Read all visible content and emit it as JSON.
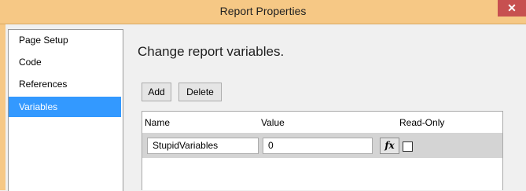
{
  "window": {
    "title": "Report Properties",
    "close_glyph": "✕"
  },
  "sidebar": {
    "items": [
      {
        "label": "Page Setup"
      },
      {
        "label": "Code"
      },
      {
        "label": "References"
      },
      {
        "label": "Variables",
        "selected": true
      }
    ]
  },
  "main": {
    "heading": "Change report variables.",
    "add_label": "Add",
    "delete_label": "Delete",
    "columns": [
      "Name",
      "Value",
      "Read-Only"
    ],
    "rows": [
      {
        "name": "StupidVariables",
        "value": "0",
        "fx_label": "fx",
        "read_only": false
      }
    ]
  },
  "colors": {
    "titlebar": "#f6c885",
    "selection": "#3399ff",
    "close_button": "#c75050",
    "row_background": "#d4d4d4"
  }
}
